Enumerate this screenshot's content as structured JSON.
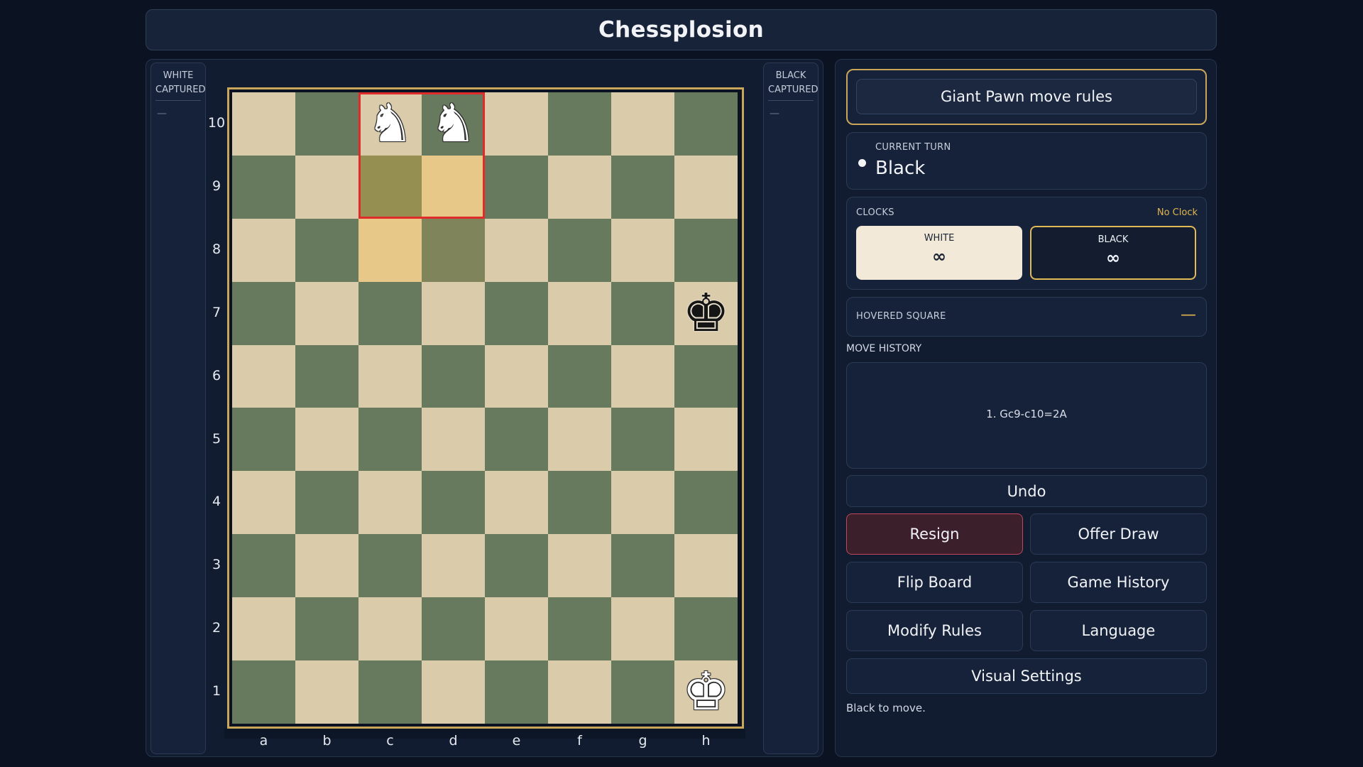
{
  "app": {
    "title": "Chessplosion"
  },
  "captured": {
    "white_label": "WHITE CAPTURED",
    "white_value": "—",
    "black_label": "BLACK CAPTURED",
    "black_value": "—"
  },
  "board": {
    "files": [
      "a",
      "b",
      "c",
      "d",
      "e",
      "f",
      "g",
      "h"
    ],
    "ranks": [
      "10",
      "9",
      "8",
      "7",
      "6",
      "5",
      "4",
      "3",
      "2",
      "1"
    ],
    "pieces": [
      {
        "square": "c10",
        "piece": "knight",
        "color": "white",
        "glyph": "♞"
      },
      {
        "square": "d10",
        "piece": "knight",
        "color": "white",
        "glyph": "♞"
      },
      {
        "square": "h7",
        "piece": "king",
        "color": "black",
        "glyph": "♚"
      },
      {
        "square": "h1",
        "piece": "king",
        "color": "white",
        "glyph": "♚"
      }
    ],
    "highlighted_squares": [
      "c9",
      "d9",
      "c8",
      "d8"
    ],
    "giant_piece_area": [
      "c10",
      "d10",
      "c9",
      "d9"
    ],
    "colors": {
      "light": "#dacbaa",
      "dark": "#687a5d",
      "frame": "#c9a659",
      "giant_outline": "#e02b2b"
    }
  },
  "sidebar": {
    "rules_button": "Giant Pawn move rules",
    "current_turn_label": "CURRENT TURN",
    "current_turn_value": "Black",
    "clocks_label": "CLOCKS",
    "clocks_mode": "No Clock",
    "white_clock_label": "WHITE",
    "white_clock_value": "∞",
    "black_clock_label": "BLACK",
    "black_clock_value": "∞",
    "hovered_label": "HOVERED SQUARE",
    "hovered_value": "—",
    "move_history_label": "MOVE HISTORY",
    "moves": [
      "1. Gc9-c10=2A"
    ],
    "buttons": {
      "undo": "Undo",
      "resign": "Resign",
      "offer_draw": "Offer Draw",
      "flip_board": "Flip Board",
      "game_history": "Game History",
      "modify_rules": "Modify Rules",
      "language": "Language",
      "visual_settings": "Visual Settings"
    },
    "status": "Black to move."
  }
}
